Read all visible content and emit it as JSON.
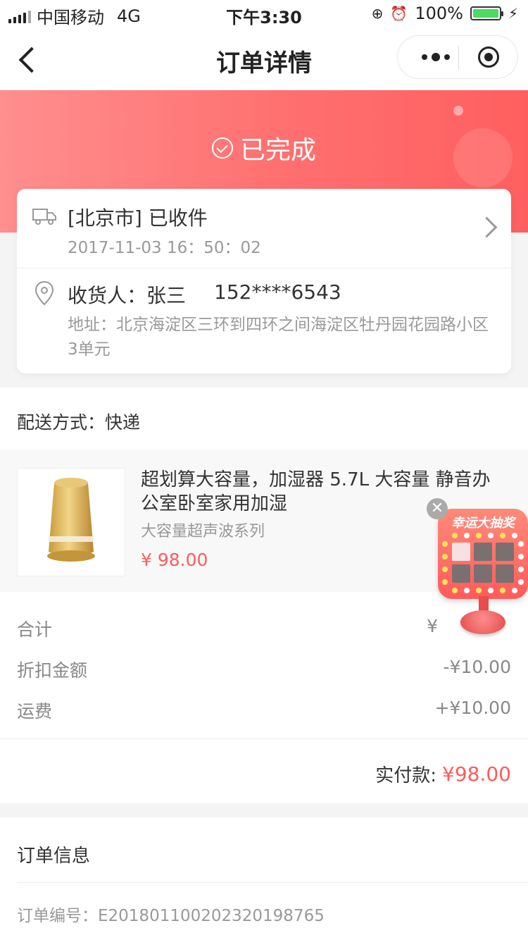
{
  "status_bar": {
    "carrier": "中国移动",
    "network": "4G",
    "time": "下午3:30",
    "battery": "100%"
  },
  "nav": {
    "title": "订单详情"
  },
  "order": {
    "status": "已完成",
    "logistics_status": "[北京市] 已收件",
    "logistics_time": "2017-11-03 16：50：02",
    "receiver_label": "收货人：张三",
    "receiver_phone": "152****6543",
    "address": "地址：北京海淀区三环到四环之间海淀区牡丹园花园路小区3单元"
  },
  "shipping": {
    "text": "配送方式：快递"
  },
  "product": {
    "title": "超划算大容量，加湿器 5.7L 大容量 静音办公室卧室家用加湿",
    "spec": "大容量超声波系列",
    "price": "¥ 98.00"
  },
  "totals": {
    "subtotal_label": "合计",
    "subtotal_value": "¥",
    "discount_label": "折扣金额",
    "discount_value": "-¥10.00",
    "shipping_label": "运费",
    "shipping_value": "+¥10.00",
    "paid_label": "实付款:",
    "paid_value": "¥98.00"
  },
  "order_info": {
    "title": "订单信息",
    "order_number": "订单编号：E20180110020232019876​5"
  },
  "lottery": {
    "title": "幸运大抽奖",
    "close": "✕"
  },
  "colors": {
    "accent": "#ff5b5b",
    "header_gradient_start": "#ff8e8e",
    "header_gradient_end": "#ff5f5f"
  }
}
